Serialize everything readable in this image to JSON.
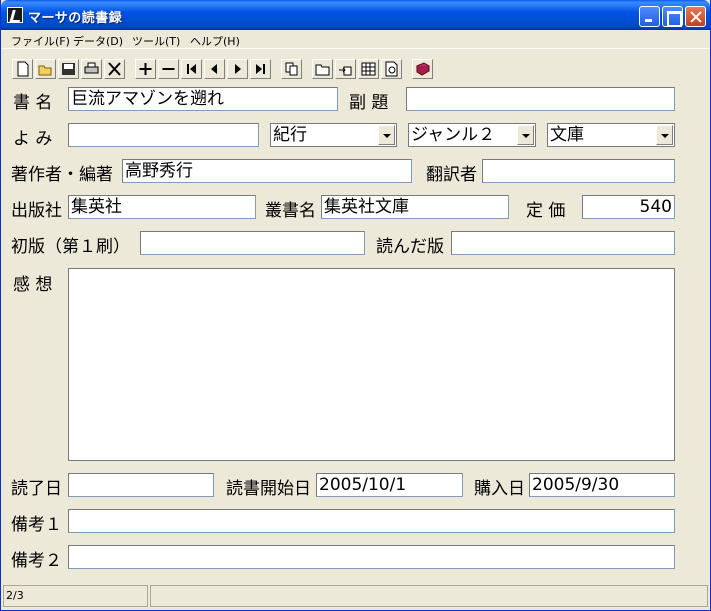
{
  "window": {
    "title": "マーサの読書録"
  },
  "menu": [
    "ファイル(F)",
    "データ(D)",
    "ツール(T)",
    "ヘルプ(H)"
  ],
  "toolbar_icons": [
    "new-icon",
    "open-icon",
    "save-icon",
    "print-icon",
    "delete-icon",
    "add-icon",
    "remove-icon",
    "first-icon",
    "prev-icon",
    "next-icon",
    "last-icon",
    "copy-icon",
    "folder-icon",
    "export-icon",
    "table-icon",
    "preview-icon",
    "book-icon"
  ],
  "labels": {
    "title": "書 名",
    "subtitle": "副 題",
    "reading": "よ み",
    "author": "著作者・編著",
    "translator": "翻訳者",
    "publisher": "出版社",
    "series": "叢書名",
    "price": "定 価",
    "first_edition": "初版（第１刷）",
    "read_edition": "読んだ版",
    "impressions": "感 想",
    "finished": "読了日",
    "started": "読書開始日",
    "purchased": "購入日",
    "note1": "備考１",
    "note2": "備考２"
  },
  "values": {
    "title": "巨流アマゾンを遡れ",
    "subtitle": "",
    "reading": "",
    "category": "紀行",
    "genre2": "ジャンル２",
    "format": "文庫",
    "author": "高野秀行",
    "translator": "",
    "publisher": "集英社",
    "series": "集英社文庫",
    "price": "540",
    "first_edition": "",
    "read_edition": "",
    "impressions": "",
    "finished": "",
    "started": "2005/10/1",
    "purchased": "2005/9/30",
    "note1": "",
    "note2": ""
  },
  "status": {
    "record": "2/3"
  }
}
